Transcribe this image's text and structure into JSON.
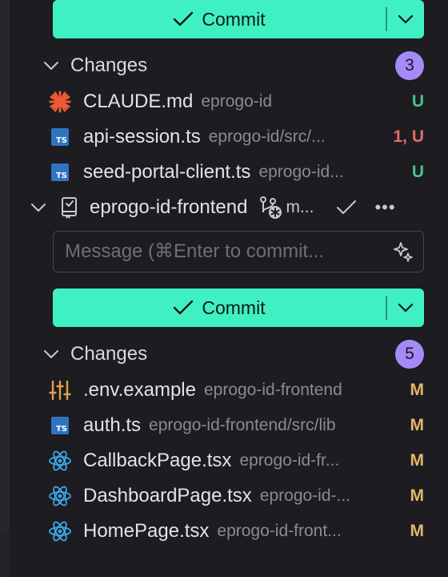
{
  "top_commit": {
    "label": "Commit"
  },
  "section1": {
    "title": "Changes",
    "count": "3",
    "files": [
      {
        "name": "CLAUDE.md",
        "path": "eprogo-id",
        "status": "U",
        "status_color": "#4cc38a",
        "icon": "claude-asterisk-icon"
      },
      {
        "name": "api-session.ts",
        "path": "eprogo-id/src/...",
        "status": "1, U",
        "status_color": "#e36a6a",
        "icon": "typescript-icon"
      },
      {
        "name": "seed-portal-client.ts",
        "path": "eprogo-id...",
        "status": "U",
        "status_color": "#4cc38a",
        "icon": "typescript-icon"
      }
    ]
  },
  "repo": {
    "name": "eprogo-id-frontend",
    "branch": "m..."
  },
  "message": {
    "placeholder": "Message (⌘Enter to commit..."
  },
  "bottom_commit": {
    "label": "Commit"
  },
  "section2": {
    "title": "Changes",
    "count": "5",
    "files": [
      {
        "name": ".env.example",
        "path": "eprogo-id-frontend",
        "status": "M",
        "status_color": "#e2b86a",
        "icon": "settings-sliders-icon"
      },
      {
        "name": "auth.ts",
        "path": "eprogo-id-frontend/src/lib",
        "status": "M",
        "status_color": "#e2b86a",
        "icon": "typescript-icon"
      },
      {
        "name": "CallbackPage.tsx",
        "path": "eprogo-id-fr...",
        "status": "M",
        "status_color": "#e2b86a",
        "icon": "react-icon"
      },
      {
        "name": "DashboardPage.tsx",
        "path": "eprogo-id-...",
        "status": "M",
        "status_color": "#e2b86a",
        "icon": "react-icon"
      },
      {
        "name": "HomePage.tsx",
        "path": "eprogo-id-front...",
        "status": "M",
        "status_color": "#e2b86a",
        "icon": "react-icon"
      }
    ]
  },
  "colors": {
    "accent": "#3ff0c3",
    "badge": "#a58af7",
    "background": "#1c1c21"
  }
}
